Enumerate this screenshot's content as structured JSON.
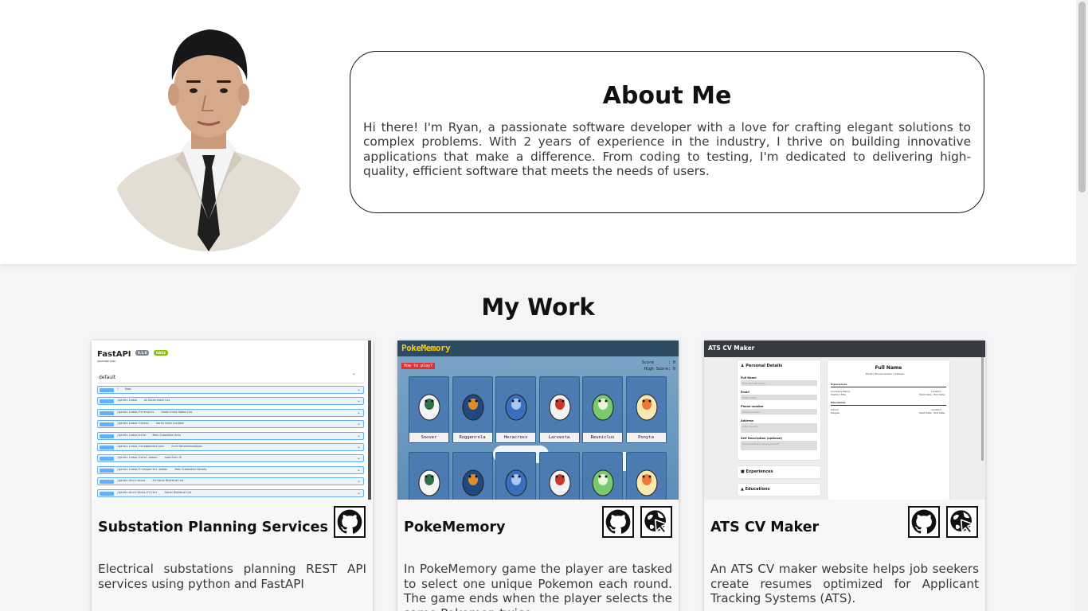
{
  "about": {
    "title": "About Me",
    "text": "Hi there! I'm Ryan, a passionate software developer with a love for crafting elegant solutions to complex problems. With 2 years of experience in the industry, I thrive on building innovative applications that make a difference. From coding to testing, I'm dedicated to delivering high-quality, efficient software that meets the needs of users."
  },
  "work": {
    "title": "My Work",
    "projects": [
      {
        "name": "Substation Planning Services",
        "description": "Electrical substations planning REST API services using python and FastAPI",
        "links": [
          "github-icon"
        ],
        "screenshot": {
          "app": "FastAPI",
          "version": "0.1.0",
          "oas": "OAS3",
          "spec_link": "/openapi.json",
          "group": "default",
          "method": "GET",
          "endpoints": [
            {
              "path": "/",
              "desc": "Root"
            },
            {
              "path": "/gardu-induk",
              "desc": "All Gardu Induk List"
            },
            {
              "path": "/gardu-induk/forecasts",
              "desc": "Gardu Induk Status List"
            },
            {
              "path": "/gardu-induk/lokasi",
              "desc": "Gardu Induk Location"
            },
            {
              "path": "/gardu-induk/area",
              "desc": "Main Substation Area"
            },
            {
              "path": "/gardu-induk/recommendations",
              "desc": "GI-GI Recommendation"
            },
            {
              "path": "/gardu-induk/total-beban",
              "desc": "Load Each GI"
            },
            {
              "path": "/gardu-induk/transporter-beban",
              "desc": "Main Substation Density"
            },
            {
              "path": "/gardu-distribusi",
              "desc": "All Gardu Distribusi List"
            },
            {
              "path": "/gardu-distribusi/filter",
              "desc": "Gardu Distribusi List"
            }
          ]
        }
      },
      {
        "name": "PokeMemory",
        "description": "In PokeMemory game the player are tasked to select one unique Pokemon each round. The game ends when the player selects the same Pokemon twice.",
        "links": [
          "github-icon",
          "live-demo-icon"
        ],
        "screenshot": {
          "logo": "PokeMemory",
          "how_to_play": "How to play?",
          "score_label": "Score",
          "score_value": "0",
          "high_score_label": "High Score",
          "high_score_value": "0",
          "pokemon": [
            "Snover",
            "Roggenrola",
            "Heracross",
            "Larvesta",
            "Reuniclus",
            "Ponyta"
          ]
        }
      },
      {
        "name": "ATS CV Maker",
        "description": "An ATS CV maker website helps job seekers create resumes optimized for Applicant Tracking Systems (ATS).",
        "links": [
          "github-icon",
          "live-demo-icon"
        ],
        "screenshot": {
          "title": "ATS CV Maker",
          "personal_details": "Personal Details",
          "fields": [
            {
              "label": "Full Name",
              "placeholder": "First and last name"
            },
            {
              "label": "Email",
              "placeholder": "Enter email"
            },
            {
              "label": "Phone number",
              "placeholder": "Phone number"
            },
            {
              "label": "Address",
              "placeholder": "City, country"
            },
            {
              "label": "Self Description (optional)",
              "placeholder": "Short summary about yourself"
            }
          ],
          "experiences": "Experiences",
          "educations": "Educations",
          "cv_name": "Full Name",
          "cv_contacts": [
            "Email",
            "Phone number",
            "Address"
          ],
          "cv_experiences": "Experiences",
          "cv_educations": "Educations",
          "cv_company": "Company Name",
          "cv_position": "Position Title",
          "cv_location": "Location",
          "cv_start_end": "Start Date - End Date",
          "cv_school": "School",
          "cv_degree": "Degree"
        }
      }
    ]
  },
  "colors": {
    "page_background": "#f5f5f7",
    "text": "#111111",
    "body_text": "#3a3a3a"
  }
}
